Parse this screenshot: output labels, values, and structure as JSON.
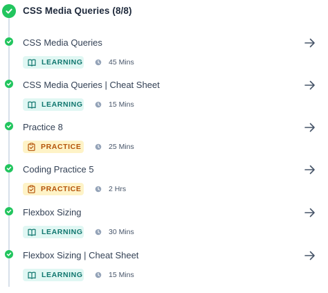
{
  "section": {
    "title": "CSS Media Queries (8/8)"
  },
  "items": [
    {
      "title": "CSS Media Queries",
      "type": "learning",
      "badge": "LEARNING",
      "duration": "45 Mins"
    },
    {
      "title": "CSS Media Queries | Cheat Sheet",
      "type": "learning",
      "badge": "LEARNING",
      "duration": "15 Mins"
    },
    {
      "title": "Practice 8",
      "type": "practice",
      "badge": "PRACTICE",
      "duration": "25 Mins"
    },
    {
      "title": "Coding Practice 5",
      "type": "practice",
      "badge": "PRACTICE",
      "duration": "2 Hrs"
    },
    {
      "title": "Flexbox Sizing",
      "type": "learning",
      "badge": "LEARNING",
      "duration": "30 Mins"
    },
    {
      "title": "Flexbox Sizing | Cheat Sheet",
      "type": "learning",
      "badge": "LEARNING",
      "duration": "15 Mins"
    }
  ],
  "colors": {
    "complete": "#22c55e",
    "learning_bg": "#e0f7f3",
    "learning_fg": "#0f766e",
    "practice_bg": "#fef3c7",
    "practice_fg": "#b45309"
  },
  "icons": {
    "section_status": "check-circle-icon",
    "item_status": "check-circle-icon",
    "learning": "book-open-icon",
    "practice": "clipboard-check-icon",
    "duration": "clock-icon",
    "open": "arrow-right-icon"
  }
}
